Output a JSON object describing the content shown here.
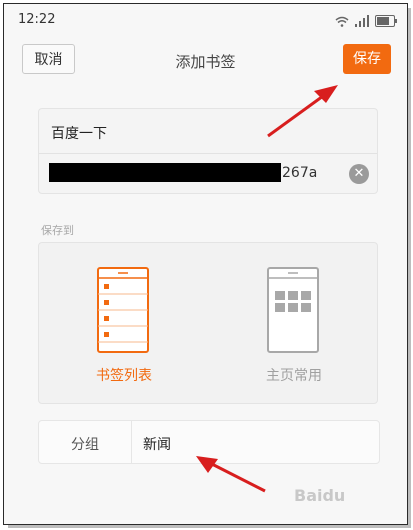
{
  "status_bar": {
    "time": "12:22"
  },
  "top_bar": {
    "cancel_label": "取消",
    "title": "添加书签",
    "save_label": "保存"
  },
  "bookmark": {
    "title": "百度一下",
    "url_visible_suffix": "267a"
  },
  "save_to": {
    "section_label": "保存到",
    "options": [
      {
        "label": "书签列表",
        "selected": true,
        "icon": "bookmark-list-icon"
      },
      {
        "label": "主页常用",
        "selected": false,
        "icon": "home-grid-icon"
      }
    ]
  },
  "group": {
    "label": "分组",
    "value": "新闻"
  },
  "watermark": {
    "text": "Baidu"
  },
  "colors": {
    "accent": "#f26a10",
    "annotation_arrow": "#d81e1e",
    "inactive": "#a0a0a0"
  }
}
